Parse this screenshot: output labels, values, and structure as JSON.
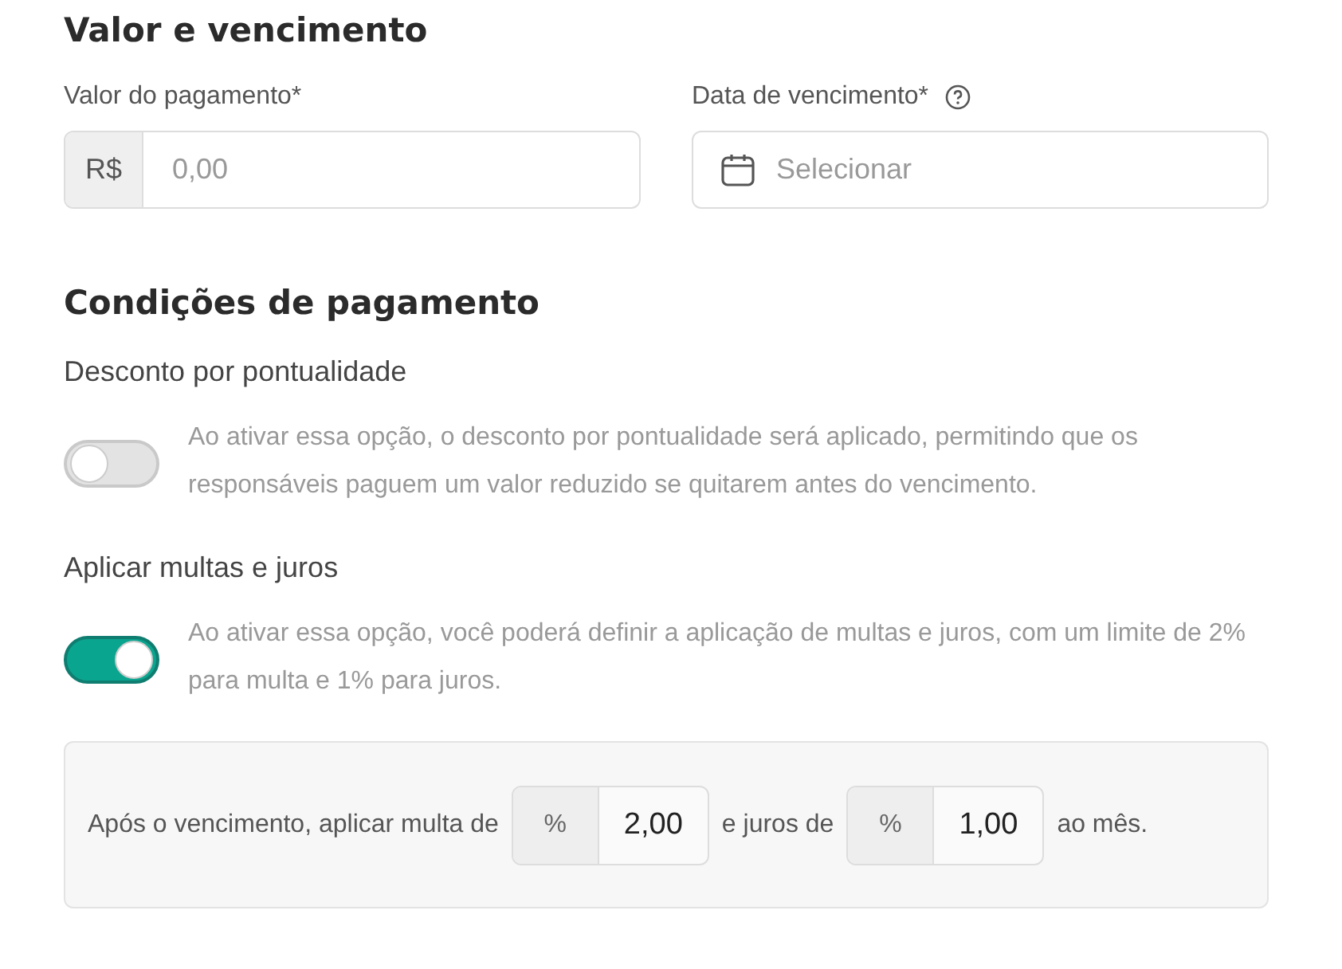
{
  "value_section": {
    "title": "Valor e vencimento",
    "amount": {
      "label": "Valor do pagamento*",
      "prefix": "R$",
      "placeholder": "0,00"
    },
    "due_date": {
      "label": "Data de vencimento*",
      "placeholder": "Selecionar"
    }
  },
  "conditions": {
    "title": "Condições de pagamento",
    "options": [
      {
        "label": "Desconto por pontualidade",
        "on": false,
        "description": "Ao ativar essa opção, o desconto por pontualidade será aplicado, permitindo que os responsáveis paguem um valor reduzido se quitarem antes do vencimento."
      },
      {
        "label": "Aplicar multas e juros",
        "on": true,
        "description": "Ao ativar essa opção, você poderá definir a aplicação de multas e juros, com um limite de 2% para multa e 1% para juros."
      }
    ],
    "penalty": [
      {
        "kind": "text",
        "text": "Após o vencimento, aplicar multa de"
      },
      {
        "kind": "input",
        "unit": "%",
        "value": "2,00"
      },
      {
        "kind": "text",
        "text": "e juros de"
      },
      {
        "kind": "input",
        "unit": "%",
        "value": "1,00"
      },
      {
        "kind": "text",
        "text": "ao mês."
      }
    ]
  }
}
